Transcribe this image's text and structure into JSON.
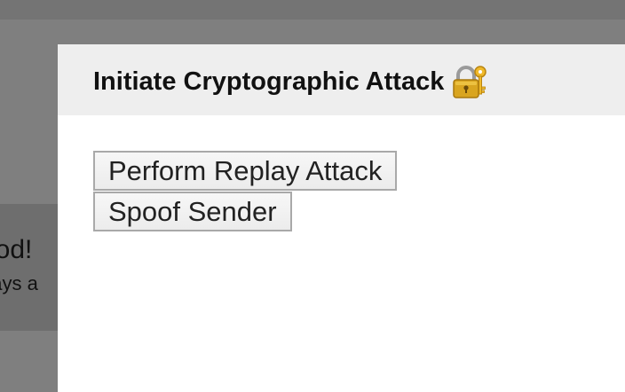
{
  "background": {
    "card_title": "ood!",
    "card_subtitle": "days a"
  },
  "modal": {
    "title": "Initiate Cryptographic Attack",
    "title_icon": "locked-with-key-icon",
    "buttons": {
      "replay_label": "Perform Replay Attack",
      "spoof_label": "Spoof Sender"
    }
  },
  "colors": {
    "overlay": "#7f7f7f",
    "header_bg": "#eeeeee",
    "modal_bg": "#ffffff",
    "button_border": "#a9a9a9"
  }
}
